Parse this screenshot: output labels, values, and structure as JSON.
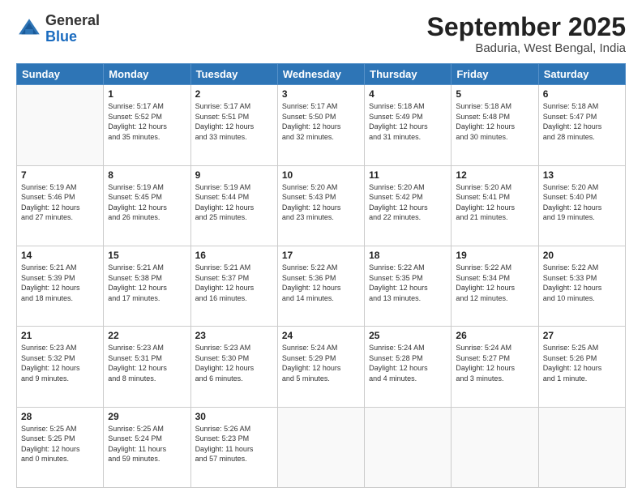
{
  "header": {
    "logo": {
      "line1": "General",
      "line2": "Blue"
    },
    "title": "September 2025",
    "subtitle": "Baduria, West Bengal, India"
  },
  "weekdays": [
    "Sunday",
    "Monday",
    "Tuesday",
    "Wednesday",
    "Thursday",
    "Friday",
    "Saturday"
  ],
  "weeks": [
    [
      {
        "day": "",
        "info": ""
      },
      {
        "day": "1",
        "info": "Sunrise: 5:17 AM\nSunset: 5:52 PM\nDaylight: 12 hours\nand 35 minutes."
      },
      {
        "day": "2",
        "info": "Sunrise: 5:17 AM\nSunset: 5:51 PM\nDaylight: 12 hours\nand 33 minutes."
      },
      {
        "day": "3",
        "info": "Sunrise: 5:17 AM\nSunset: 5:50 PM\nDaylight: 12 hours\nand 32 minutes."
      },
      {
        "day": "4",
        "info": "Sunrise: 5:18 AM\nSunset: 5:49 PM\nDaylight: 12 hours\nand 31 minutes."
      },
      {
        "day": "5",
        "info": "Sunrise: 5:18 AM\nSunset: 5:48 PM\nDaylight: 12 hours\nand 30 minutes."
      },
      {
        "day": "6",
        "info": "Sunrise: 5:18 AM\nSunset: 5:47 PM\nDaylight: 12 hours\nand 28 minutes."
      }
    ],
    [
      {
        "day": "7",
        "info": "Sunrise: 5:19 AM\nSunset: 5:46 PM\nDaylight: 12 hours\nand 27 minutes."
      },
      {
        "day": "8",
        "info": "Sunrise: 5:19 AM\nSunset: 5:45 PM\nDaylight: 12 hours\nand 26 minutes."
      },
      {
        "day": "9",
        "info": "Sunrise: 5:19 AM\nSunset: 5:44 PM\nDaylight: 12 hours\nand 25 minutes."
      },
      {
        "day": "10",
        "info": "Sunrise: 5:20 AM\nSunset: 5:43 PM\nDaylight: 12 hours\nand 23 minutes."
      },
      {
        "day": "11",
        "info": "Sunrise: 5:20 AM\nSunset: 5:42 PM\nDaylight: 12 hours\nand 22 minutes."
      },
      {
        "day": "12",
        "info": "Sunrise: 5:20 AM\nSunset: 5:41 PM\nDaylight: 12 hours\nand 21 minutes."
      },
      {
        "day": "13",
        "info": "Sunrise: 5:20 AM\nSunset: 5:40 PM\nDaylight: 12 hours\nand 19 minutes."
      }
    ],
    [
      {
        "day": "14",
        "info": "Sunrise: 5:21 AM\nSunset: 5:39 PM\nDaylight: 12 hours\nand 18 minutes."
      },
      {
        "day": "15",
        "info": "Sunrise: 5:21 AM\nSunset: 5:38 PM\nDaylight: 12 hours\nand 17 minutes."
      },
      {
        "day": "16",
        "info": "Sunrise: 5:21 AM\nSunset: 5:37 PM\nDaylight: 12 hours\nand 16 minutes."
      },
      {
        "day": "17",
        "info": "Sunrise: 5:22 AM\nSunset: 5:36 PM\nDaylight: 12 hours\nand 14 minutes."
      },
      {
        "day": "18",
        "info": "Sunrise: 5:22 AM\nSunset: 5:35 PM\nDaylight: 12 hours\nand 13 minutes."
      },
      {
        "day": "19",
        "info": "Sunrise: 5:22 AM\nSunset: 5:34 PM\nDaylight: 12 hours\nand 12 minutes."
      },
      {
        "day": "20",
        "info": "Sunrise: 5:22 AM\nSunset: 5:33 PM\nDaylight: 12 hours\nand 10 minutes."
      }
    ],
    [
      {
        "day": "21",
        "info": "Sunrise: 5:23 AM\nSunset: 5:32 PM\nDaylight: 12 hours\nand 9 minutes."
      },
      {
        "day": "22",
        "info": "Sunrise: 5:23 AM\nSunset: 5:31 PM\nDaylight: 12 hours\nand 8 minutes."
      },
      {
        "day": "23",
        "info": "Sunrise: 5:23 AM\nSunset: 5:30 PM\nDaylight: 12 hours\nand 6 minutes."
      },
      {
        "day": "24",
        "info": "Sunrise: 5:24 AM\nSunset: 5:29 PM\nDaylight: 12 hours\nand 5 minutes."
      },
      {
        "day": "25",
        "info": "Sunrise: 5:24 AM\nSunset: 5:28 PM\nDaylight: 12 hours\nand 4 minutes."
      },
      {
        "day": "26",
        "info": "Sunrise: 5:24 AM\nSunset: 5:27 PM\nDaylight: 12 hours\nand 3 minutes."
      },
      {
        "day": "27",
        "info": "Sunrise: 5:25 AM\nSunset: 5:26 PM\nDaylight: 12 hours\nand 1 minute."
      }
    ],
    [
      {
        "day": "28",
        "info": "Sunrise: 5:25 AM\nSunset: 5:25 PM\nDaylight: 12 hours\nand 0 minutes."
      },
      {
        "day": "29",
        "info": "Sunrise: 5:25 AM\nSunset: 5:24 PM\nDaylight: 11 hours\nand 59 minutes."
      },
      {
        "day": "30",
        "info": "Sunrise: 5:26 AM\nSunset: 5:23 PM\nDaylight: 11 hours\nand 57 minutes."
      },
      {
        "day": "",
        "info": ""
      },
      {
        "day": "",
        "info": ""
      },
      {
        "day": "",
        "info": ""
      },
      {
        "day": "",
        "info": ""
      }
    ]
  ]
}
